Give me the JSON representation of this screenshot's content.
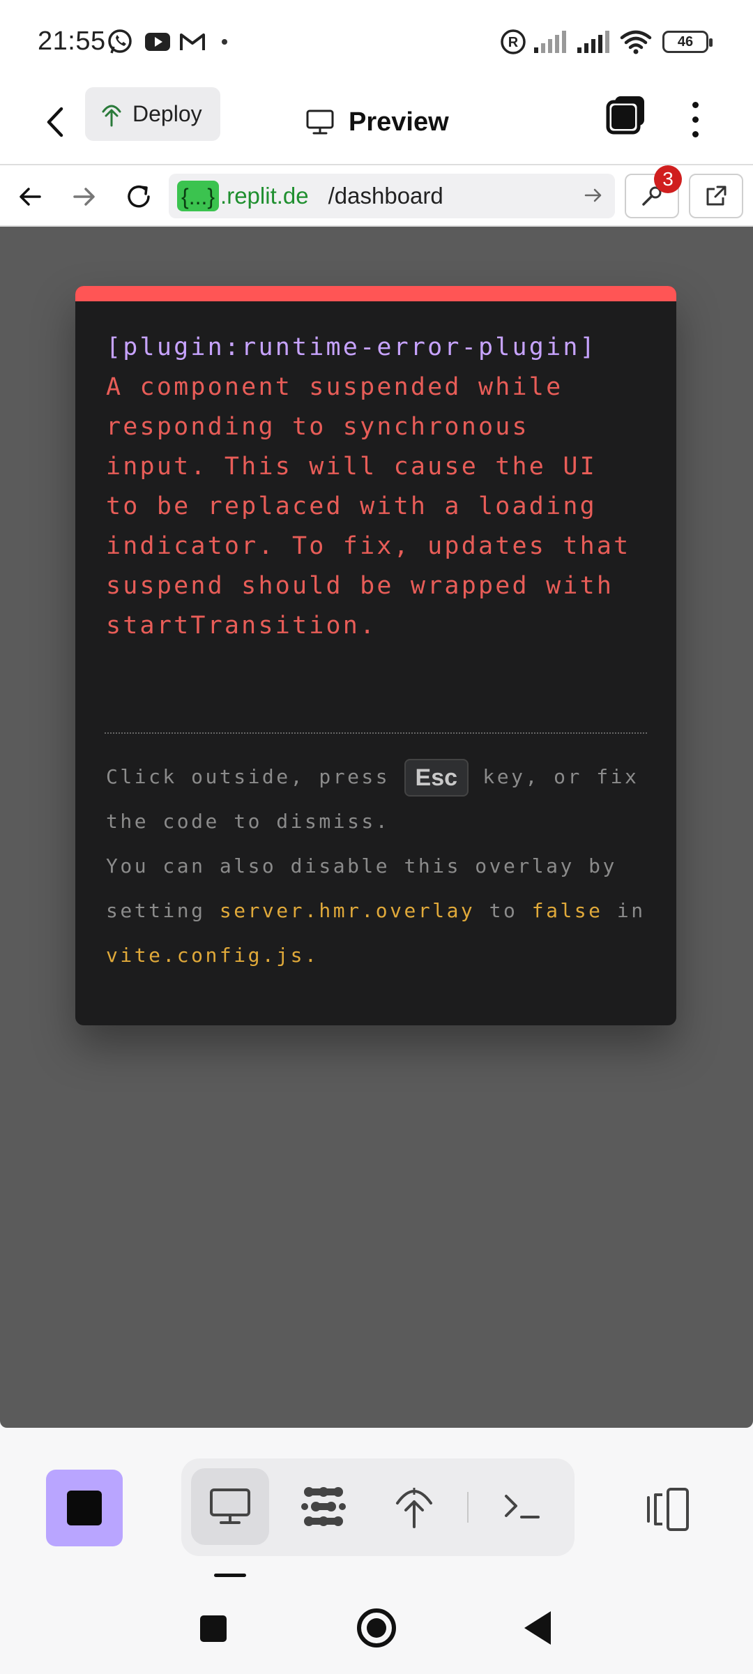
{
  "status_bar": {
    "time": "21:55",
    "battery": "46",
    "icons": [
      "whatsapp-icon",
      "youtube-icon",
      "gmail-icon",
      "registered-icon",
      "signal-icon",
      "signal-icon",
      "wifi-icon",
      "battery-icon"
    ]
  },
  "header": {
    "deploy_label": "Deploy",
    "preview_label": "Preview"
  },
  "url_bar": {
    "prefix": "{...}",
    "domain": ".replit.de",
    "path": "/dashboard",
    "tools_badge": "3"
  },
  "overlay": {
    "plugin": "[plugin:runtime-error-plugin]",
    "message": "A component suspended while responding to synchronous input. This will cause the UI to be replaced with a loading indicator. To fix, updates that suspend should be wrapped with startTransition.",
    "tip": {
      "part1": "Click outside, press ",
      "key": "Esc",
      "part2": " key, or fix the code to dismiss.",
      "part3": "You can also disable this overlay by setting ",
      "code1": "server.hmr.overlay",
      "part4": " to ",
      "code2": "false",
      "part5": " in ",
      "code3": "vite.config.js",
      "part6": "."
    }
  },
  "colors": {
    "accent_error": "#ff5555",
    "error_text": "#e85d58",
    "plugin_text": "#c7a3ff",
    "code_text": "#e0a93a",
    "stop_button": "#b9a5ff",
    "url_prefix_bg": "#3bc34f"
  }
}
